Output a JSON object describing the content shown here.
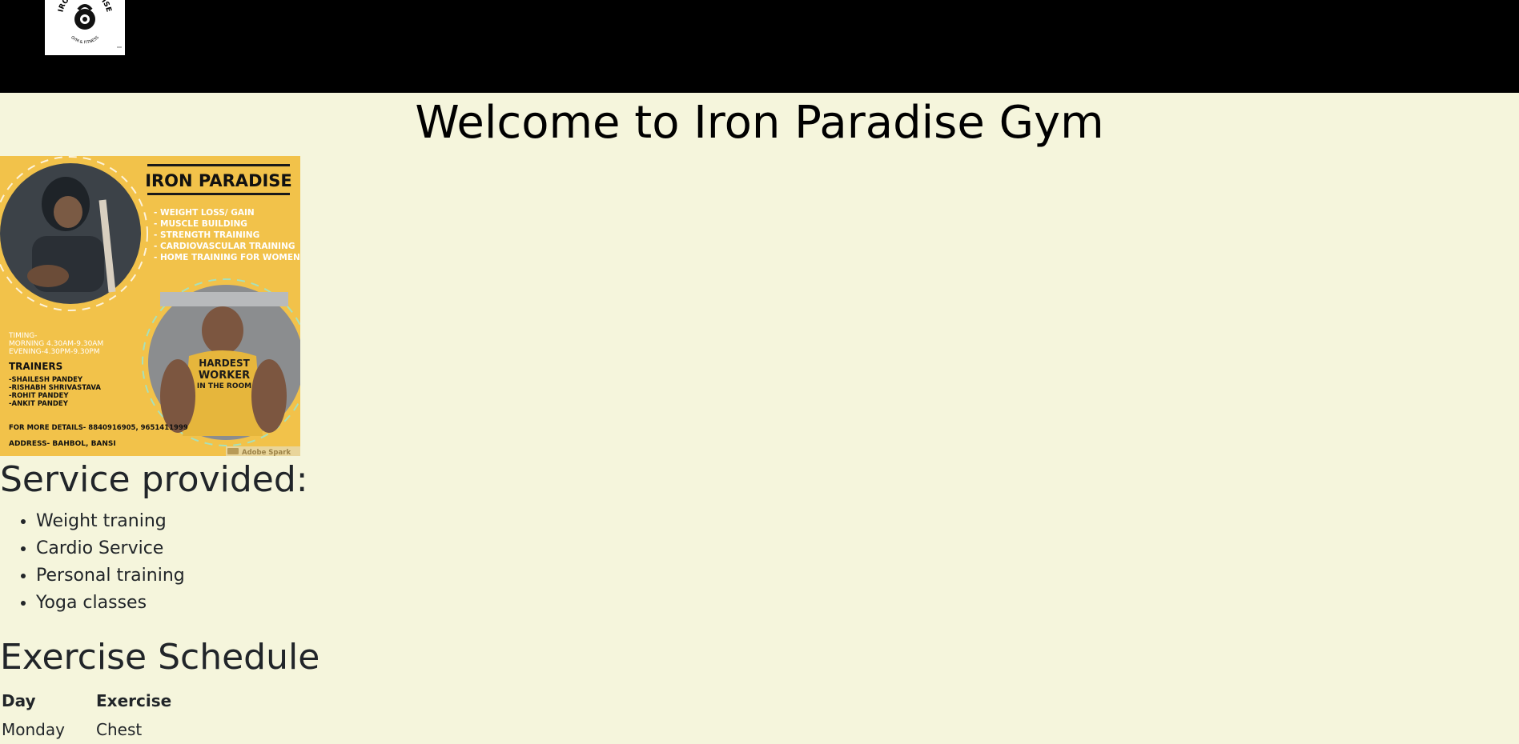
{
  "header": {
    "logo_name": "IRON PARADISE",
    "logo_tagline": "GYM & FITNESS"
  },
  "page": {
    "title": "Welcome to Iron Paradise Gym"
  },
  "poster": {
    "title": "IRON PARADISE",
    "services": [
      "- WEIGHT LOSS/ GAIN",
      "- MUSCLE BUILDING",
      "- STRENGTH TRAINING",
      "- CARDIOVASCULAR TRAINING",
      "- HOME TRAINING FOR WOMEN"
    ],
    "timing": [
      "TIMING-",
      "MORNING 4.30AM-9.30AM",
      "EVENING-4.30PM-9.30PM"
    ],
    "trainers_heading": "TRAINERS",
    "trainers": [
      "-SHAILESH PANDEY",
      "-RISHABH SHRIVASTAVA",
      "-ROHIT PANDEY",
      "-ANKIT PANDEY"
    ],
    "contact": "FOR MORE DETAILS- 8840916905, 9651411999",
    "address": "ADDRESS- BAHBOL, BANSI",
    "shirt_text": [
      "HARDEST",
      "WORKER",
      "IN THE ROOM"
    ],
    "watermark": "Adobe Spark"
  },
  "services": {
    "heading": "Service provided:",
    "items": [
      "Weight traning",
      "Cardio Service",
      "Personal training",
      "Yoga classes"
    ]
  },
  "schedule": {
    "heading": "Exercise Schedule",
    "columns": [
      "Day",
      "Exercise"
    ],
    "rows": [
      [
        "Monday",
        "Chest"
      ]
    ]
  },
  "colors": {
    "page_background": "#f5f5dc",
    "topbar": "#000000",
    "poster_background": "#f2c24a"
  }
}
